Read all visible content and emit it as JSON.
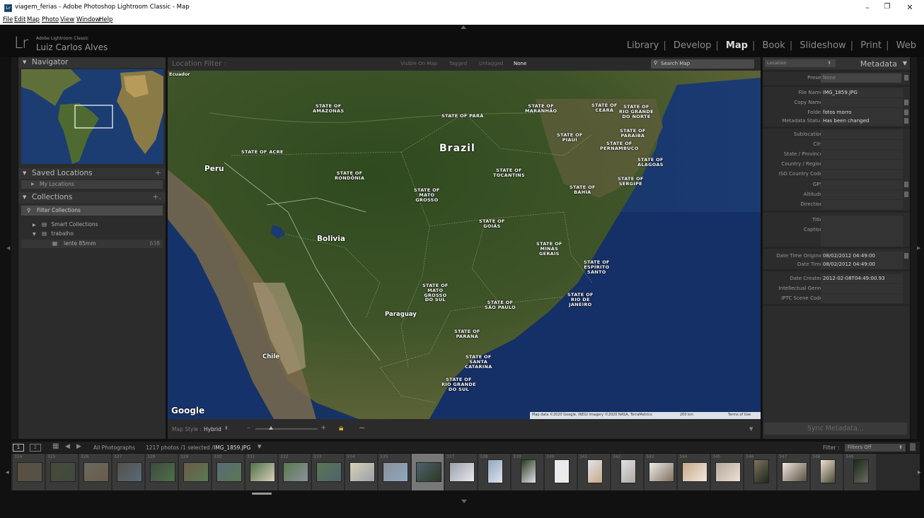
{
  "window": {
    "title": "viagem_ferias - Adobe Photoshop Lightroom Classic - Map",
    "app_icon": "Lr",
    "controls": {
      "minimize": "–",
      "maximize": "❐",
      "close": "✕"
    }
  },
  "menu": [
    "File",
    "Edit",
    "Map",
    "Photo",
    "View",
    "Window",
    "Help"
  ],
  "identity": {
    "logo": "Lr",
    "product": "Adobe Lightroom Classic",
    "user": "Luiz Carlos Alves"
  },
  "modules": [
    "Library",
    "Develop",
    "Map",
    "Book",
    "Slideshow",
    "Print",
    "Web"
  ],
  "active_module": "Map",
  "left_panel": {
    "navigator_label": "Navigator",
    "saved_locations_label": "Saved Locations",
    "my_locations": "My Locations",
    "collections_label": "Collections",
    "filter_collections": "Filter Collections",
    "smart_collections": "Smart Collections",
    "trabalho": "trabalho",
    "lente": "lente 85mm",
    "lente_count": "638"
  },
  "map_bar": {
    "location_filter": "Location Filter :",
    "filters": [
      "Visible On Map",
      "Tagged",
      "Untagged",
      "None"
    ],
    "active_filter": "None",
    "search_placeholder": "Search Map"
  },
  "map_labels": {
    "countries": [
      "Brazil",
      "Peru",
      "Bolivia",
      "Paraguay",
      "Chile"
    ],
    "ecuador": "Ecuador",
    "states": {
      "amazonas": "STATE OF\nAMAZONAS",
      "para": "STATE OF PARÁ",
      "maranhao": "STATE OF\nMARANHÃO",
      "ceara": "STATE OF\nCEARÁ",
      "rgn": "STATE OF\nRIO GRANDE\nDO NORTE",
      "paraiba": "STATE OF\nPARAÍBA",
      "piaui": "STATE OF\nPIAUÍ",
      "pernambuco": "STATE OF\nPERNAMBUCO",
      "alagoas": "STATE OF\nALAGOAS",
      "sergipe": "STATE OF\nSERGIPE",
      "acre": "STATE OF ACRE",
      "rondonia": "STATE OF\nRONDÔNIA",
      "tocantins": "STATE OF\nTOCANTINS",
      "bahia": "STATE OF\nBAHIA",
      "mato_grosso": "STATE OF\nMATO\nGROSSO",
      "goias": "STATE OF\nGOIÁS",
      "minas": "STATE OF\nMINAS\nGERAIS",
      "espirito": "STATE OF\nESPÍRITO\nSANTO",
      "ms": "STATE OF\nMATO\nGROSSO\nDO SUL",
      "sao_paulo": "STATE OF\nSÃO PAULO",
      "rio": "STATE OF\nRIO DE\nJANEIRO",
      "parana": "STATE OF\nPARANÁ",
      "santa_catarina": "STATE OF\nSANTA\nCATARINA",
      "rgs": "STATE OF\nRIO GRANDE\nDO SUL"
    },
    "google": "Google",
    "attribution": "Map data ©2020 Google, INEGI Imagery ©2020 NASA, TerraMetrics",
    "scale": "200 km",
    "terms": "Terms of Use"
  },
  "map_footer": {
    "map_style_label": "Map Style :",
    "map_style_value": "Hybrid",
    "zoom_fraction": 0.25
  },
  "right_panel": {
    "dropdown": "Location",
    "title": "Metadata",
    "preset_label": "Preset",
    "preset_value": "None",
    "fields": [
      {
        "k": "File Name",
        "v": "IMG_1859.JPG"
      },
      {
        "k": "Copy Name",
        "v": ""
      },
      {
        "k": "Folder",
        "v": "fotos morro"
      },
      {
        "k": "Metadata Status",
        "v": "Has been changed"
      },
      {
        "k": "Sublocation",
        "v": ""
      },
      {
        "k": "City",
        "v": ""
      },
      {
        "k": "State / Province",
        "v": ""
      },
      {
        "k": "Country / Region",
        "v": ""
      },
      {
        "k": "ISO Country Code",
        "v": ""
      },
      {
        "k": "GPS",
        "v": ""
      },
      {
        "k": "Altitude",
        "v": ""
      },
      {
        "k": "Direction",
        "v": ""
      },
      {
        "k": "Title",
        "v": ""
      },
      {
        "k": "Caption",
        "v": ""
      },
      {
        "k": "Date Time Original",
        "v": "08/02/2012 04:49:00"
      },
      {
        "k": "Date Time",
        "v": "08/02/2012 04:49:00"
      },
      {
        "k": "Date Created",
        "v": "2012-02-08T04:49:00.93"
      },
      {
        "k": "Intellectual Genre",
        "v": ""
      },
      {
        "k": "IPTC Scene Code",
        "v": ""
      }
    ],
    "sync_button": "Sync Metadata..."
  },
  "filmstrip_bar": {
    "screen1": "1",
    "screen2": "2",
    "source": "All Photographs",
    "count": "1217 photos /1 selected /",
    "selected_file": "IMG_1859.JPG",
    "filter_label": "Filter :",
    "filter_value": "Filters Off"
  },
  "filmstrip": {
    "numbers": [
      "324",
      "325",
      "326",
      "327",
      "328",
      "329",
      "330",
      "331",
      "332",
      "333",
      "334",
      "335",
      "336",
      "337",
      "338",
      "339",
      "340",
      "341",
      "342",
      "343",
      "344",
      "345",
      "346",
      "347",
      "348",
      "349"
    ],
    "selected_index": 12
  },
  "colors": {
    "panel_bg": "#2c2c2c",
    "accent_active": "#dddddd",
    "ocean": "#0f2349",
    "land": "#3a4a2a"
  }
}
